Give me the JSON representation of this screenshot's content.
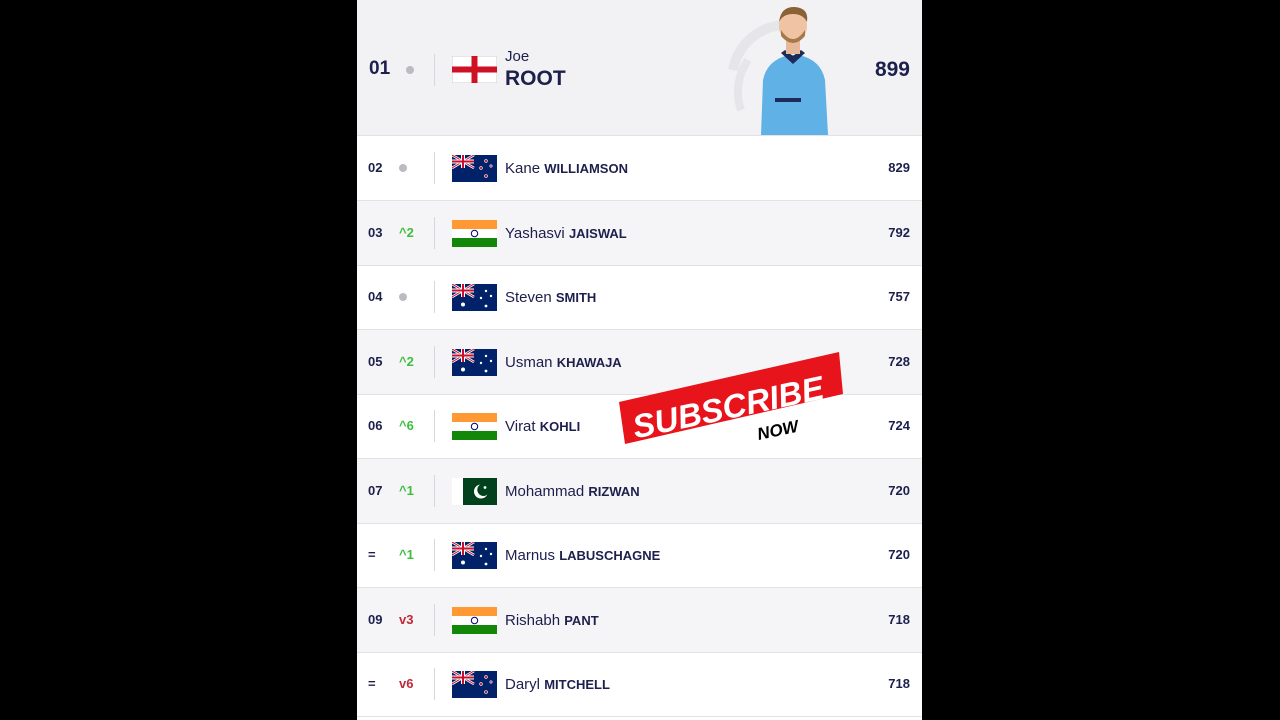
{
  "leader": {
    "rank": "01",
    "first_name": "Joe",
    "last_name": "ROOT",
    "points": "899",
    "country_flag": "england-flag",
    "movement": "none"
  },
  "rows": [
    {
      "rank": "02",
      "move": "",
      "move_type": "same",
      "first": "Kane",
      "last": "WILLIAMSON",
      "points": "829",
      "flag": "new-zealand"
    },
    {
      "rank": "03",
      "move": "^2",
      "move_type": "up",
      "first": "Yashasvi",
      "last": "JAISWAL",
      "points": "792",
      "flag": "india"
    },
    {
      "rank": "04",
      "move": "",
      "move_type": "same",
      "first": "Steven",
      "last": "SMITH",
      "points": "757",
      "flag": "australia"
    },
    {
      "rank": "05",
      "move": "^2",
      "move_type": "up",
      "first": "Usman",
      "last": "KHAWAJA",
      "points": "728",
      "flag": "australia"
    },
    {
      "rank": "06",
      "move": "^6",
      "move_type": "up",
      "first": "Virat",
      "last": "KOHLI",
      "points": "724",
      "flag": "india"
    },
    {
      "rank": "07",
      "move": "^1",
      "move_type": "up",
      "first": "Mohammad",
      "last": "RIZWAN",
      "points": "720",
      "flag": "pakistan"
    },
    {
      "rank": "=",
      "move": "^1",
      "move_type": "up",
      "first": "Marnus",
      "last": "LABUSCHAGNE",
      "points": "720",
      "flag": "australia"
    },
    {
      "rank": "09",
      "move": "v3",
      "move_type": "down",
      "first": "Rishabh",
      "last": "PANT",
      "points": "718",
      "flag": "india"
    },
    {
      "rank": "=",
      "move": "v6",
      "move_type": "down",
      "first": "Daryl",
      "last": "MITCHELL",
      "points": "718",
      "flag": "new-zealand"
    }
  ],
  "overlay": {
    "subscribe": "SUBSCRIBE",
    "now": "NOW"
  },
  "colors": {
    "navy": "#1d1f4c",
    "up": "#3cc03c",
    "down": "#c0283a",
    "subscribe_red": "#e8141c"
  }
}
